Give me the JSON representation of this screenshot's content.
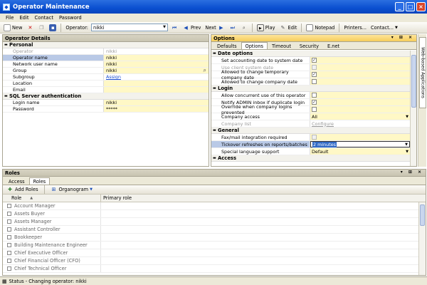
{
  "window": {
    "title": "Operator Maintenance"
  },
  "menu": [
    "File",
    "Edit",
    "Contact",
    "Password"
  ],
  "toolbar": {
    "new": "New",
    "operator_label": "Operator:",
    "operator_value": "nikki",
    "prev": "Prev",
    "next": "Next",
    "play": "Play",
    "edit": "Edit",
    "notepad": "Notepad",
    "printers": "Printers...",
    "contact": "Contact..."
  },
  "operator_details": {
    "title": "Operator Details",
    "sections": [
      {
        "name": "Personal",
        "rows": [
          {
            "label": "Operator",
            "value": "nikki",
            "dim": true
          },
          {
            "label": "Operator name",
            "value": "nikki",
            "selected": true
          },
          {
            "label": "Network user name",
            "value": "nikki"
          },
          {
            "label": "Group",
            "value": "nikki"
          },
          {
            "label": "Subgroup",
            "value": "Assign",
            "link": true
          },
          {
            "label": "Location",
            "value": ""
          },
          {
            "label": "Email",
            "value": ""
          }
        ]
      },
      {
        "name": "SQL Server authentication",
        "rows": [
          {
            "label": "Login name",
            "value": "nikki"
          },
          {
            "label": "Password",
            "value": "*****"
          }
        ]
      }
    ]
  },
  "options": {
    "title": "Options",
    "tabs": [
      "Defaults",
      "Options",
      "Timeout",
      "Security",
      "E.net"
    ],
    "active_tab": "Options",
    "sections": [
      {
        "name": "Date options",
        "rows": [
          {
            "label": "Set accounting date to system date",
            "type": "check",
            "checked": true
          },
          {
            "label": "Use client system date",
            "type": "check",
            "checked": false,
            "dim": true
          },
          {
            "label": "Allowed to change temporary company date",
            "type": "check",
            "checked": true
          },
          {
            "label": "Allowed to change company date",
            "type": "check",
            "checked": false
          }
        ]
      },
      {
        "name": "Login",
        "rows": [
          {
            "label": "Allow concurrent use of this operator",
            "type": "check",
            "checked": false
          },
          {
            "label": "Notify ADMIN inbox if duplicate login",
            "type": "check",
            "checked": true
          },
          {
            "label": "Override when company logins prevented",
            "type": "check",
            "checked": false
          },
          {
            "label": "Company access",
            "type": "combo",
            "value": "All"
          },
          {
            "label": "Company list",
            "type": "link",
            "value": "Configure",
            "dim": true
          }
        ]
      },
      {
        "name": "General",
        "rows": [
          {
            "label": "Fax/mail integration required",
            "type": "check",
            "checked": false
          },
          {
            "label": "Tickover refreshes on reports/batches",
            "type": "combo",
            "value": "2 minutes",
            "selected": true
          },
          {
            "label": "Special language support",
            "type": "combo",
            "value": "Default"
          }
        ]
      },
      {
        "name": "Access",
        "rows": []
      }
    ],
    "side_tab": "Web-based Applications"
  },
  "roles": {
    "title": "Roles",
    "tabs": [
      "Access",
      "Roles"
    ],
    "active_tab": "Roles",
    "add_roles": "Add Roles",
    "organogram": "Organogram",
    "columns": [
      "Role",
      "Primary role"
    ],
    "items": [
      "Account Manager",
      "Assets Buyer",
      "Assets Manager",
      "Assistant Controller",
      "Bookkeeper",
      "Building Maintenance Engineer",
      "Chief Executive Officer",
      "Chief Financial Officer (CFO)",
      "Chief Technical Officer"
    ]
  },
  "status": {
    "text": "Status - Changing operator: nikki"
  },
  "colors": {
    "title_bar": "#0a4fd0",
    "panel_highlight": "#f5cd5a",
    "value_bg": "#fff8c6"
  }
}
